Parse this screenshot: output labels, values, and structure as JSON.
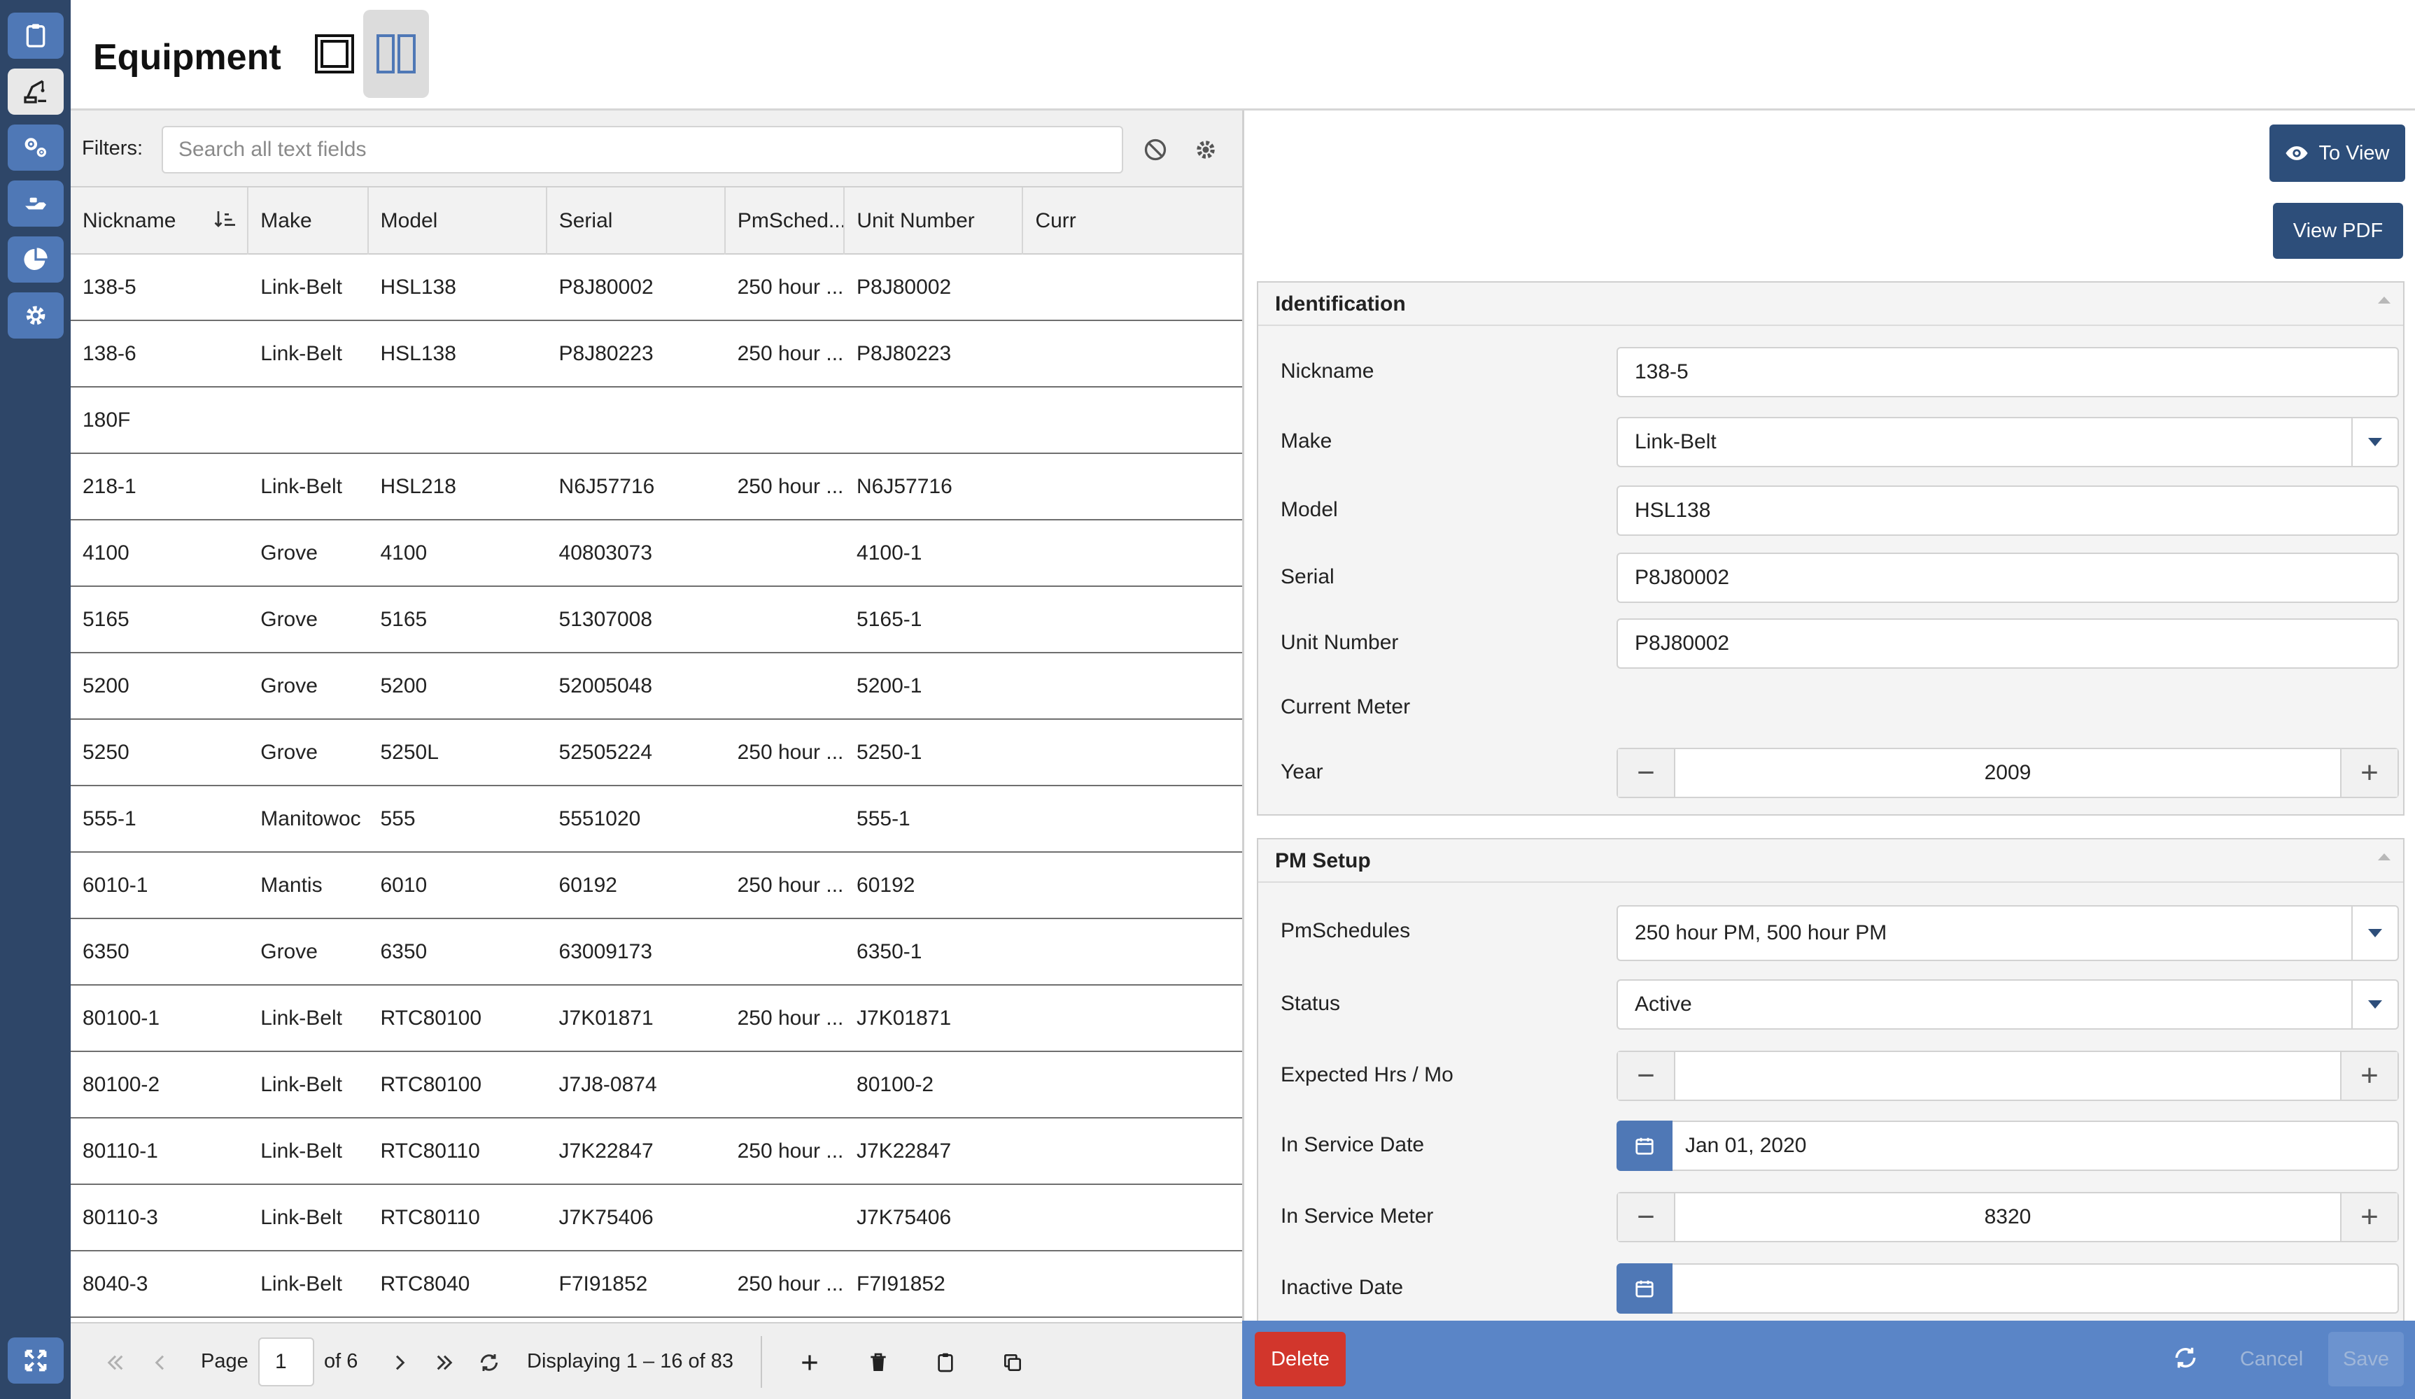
{
  "page": {
    "title": "Equipment"
  },
  "rail": {
    "items": [
      {
        "icon": "clipboard-icon"
      },
      {
        "icon": "crane-icon"
      },
      {
        "icon": "gears-icon"
      },
      {
        "icon": "hand-icon"
      },
      {
        "icon": "pie-chart-icon"
      },
      {
        "icon": "settings-icon"
      }
    ],
    "bottom_icon": "expand-icon"
  },
  "filters": {
    "label": "Filters:",
    "placeholder": "Search all text fields"
  },
  "grid": {
    "columns": [
      "Nickname",
      "Make",
      "Model",
      "Serial",
      "PmSched...",
      "Unit Number",
      "Curr"
    ],
    "rows": [
      [
        "138-5",
        "Link-Belt",
        "HSL138",
        "P8J80002",
        "250 hour ...",
        "P8J80002"
      ],
      [
        "138-6",
        "Link-Belt",
        "HSL138",
        "P8J80223",
        "250 hour ...",
        "P8J80223"
      ],
      [
        "180F",
        "",
        "",
        "",
        "",
        ""
      ],
      [
        "218-1",
        "Link-Belt",
        "HSL218",
        "N6J57716",
        "250 hour ...",
        "N6J57716"
      ],
      [
        "4100",
        "Grove",
        "4100",
        "40803073",
        "",
        "4100-1"
      ],
      [
        "5165",
        "Grove",
        "5165",
        "51307008",
        "",
        "5165-1"
      ],
      [
        "5200",
        "Grove",
        "5200",
        "52005048",
        "",
        "5200-1"
      ],
      [
        "5250",
        "Grove",
        "5250L",
        "52505224",
        "250 hour ...",
        "5250-1"
      ],
      [
        "555-1",
        "Manitowoc",
        "555",
        "5551020",
        "",
        "555-1"
      ],
      [
        "6010-1",
        "Mantis",
        "6010",
        "60192",
        "250 hour ...",
        "60192"
      ],
      [
        "6350",
        "Grove",
        "6350",
        "63009173",
        "",
        "6350-1"
      ],
      [
        "80100-1",
        "Link-Belt",
        "RTC80100",
        "J7K01871",
        "250 hour ...",
        "J7K01871"
      ],
      [
        "80100-2",
        "Link-Belt",
        "RTC80100",
        "J7J8-0874",
        "",
        "80100-2"
      ],
      [
        "80110-1",
        "Link-Belt",
        "RTC80110",
        "J7K22847",
        "250 hour ...",
        "J7K22847"
      ],
      [
        "80110-3",
        "Link-Belt",
        "RTC80110",
        "J7K75406",
        "",
        "J7K75406"
      ],
      [
        "8040-3",
        "Link-Belt",
        "RTC8040",
        "F7I91852",
        "250 hour ...",
        "F7I91852"
      ]
    ]
  },
  "pager": {
    "page_label": "Page",
    "page_value": "1",
    "of_label": "of 6",
    "displaying": "Displaying 1 – 16 of 83"
  },
  "detail": {
    "to_view_label": "To View",
    "view_pdf_label": "View PDF",
    "identification": {
      "title": "Identification",
      "nickname_label": "Nickname",
      "nickname_value": "138-5",
      "make_label": "Make",
      "make_value": "Link-Belt",
      "model_label": "Model",
      "model_value": "HSL138",
      "serial_label": "Serial",
      "serial_value": "P8J80002",
      "unit_label": "Unit Number",
      "unit_value": "P8J80002",
      "meter_label": "Current Meter",
      "year_label": "Year",
      "year_value": "2009"
    },
    "pm_setup": {
      "title": "PM Setup",
      "schedules_label": "PmSchedules",
      "schedules_value": "250 hour PM, 500 hour PM",
      "status_label": "Status",
      "status_value": "Active",
      "expected_label": "Expected Hrs / Mo",
      "expected_value": "",
      "service_date_label": "In Service Date",
      "service_date_value": "Jan 01, 2020",
      "service_meter_label": "In Service Meter",
      "service_meter_value": "8320",
      "inactive_label": "Inactive Date",
      "inactive_value": ""
    }
  },
  "actions": {
    "delete_label": "Delete",
    "cancel_label": "Cancel",
    "save_label": "Save"
  },
  "colors": {
    "rail": "#2e4668",
    "rail_button": "#4f78b6",
    "primary_dark": "#2d4e7a",
    "action_bar": "#5a85c7",
    "delete": "#d2362c"
  }
}
